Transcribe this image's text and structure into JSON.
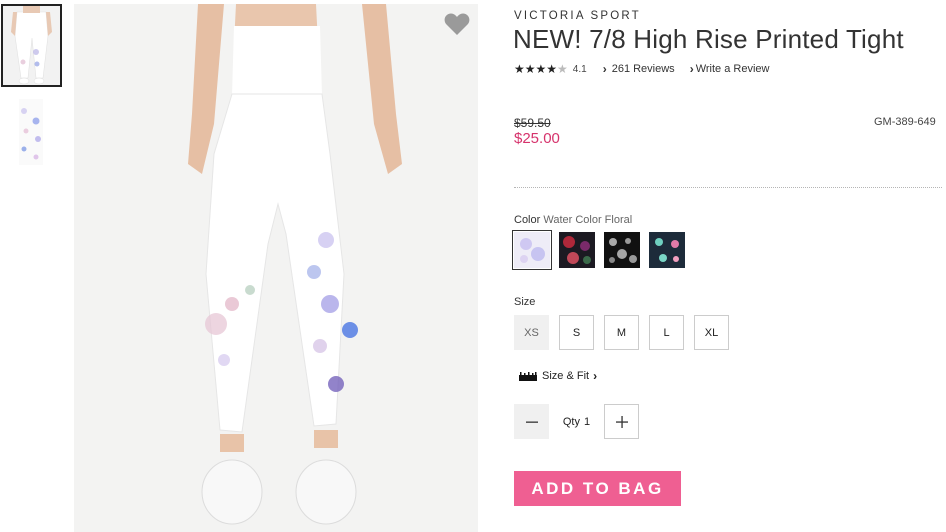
{
  "product": {
    "brand": "VICTORIA SPORT",
    "title": "NEW! 7/8 High Rise Printed Tight",
    "rating_value": "4.1",
    "reviews_link": "261 Reviews",
    "write_review_link": "Write a Review",
    "rating_stars": 4.1
  },
  "pricing": {
    "original_price": "$59.50",
    "sale_price": "$25.00",
    "sku": "GM-389-649",
    "sale_color": "#d6336c"
  },
  "color": {
    "label": "Color",
    "selected_name": "Water Color Floral",
    "swatches": [
      "water-color-floral",
      "dark-floral-red",
      "black-floral",
      "navy-floral"
    ]
  },
  "size": {
    "label": "Size",
    "options": [
      "XS",
      "S",
      "M",
      "L",
      "XL"
    ],
    "unavailable": [
      "XS"
    ],
    "size_fit_link": "Size & Fit"
  },
  "quantity": {
    "label": "Qty",
    "value": "1"
  },
  "actions": {
    "add_to_bag": "ADD TO BAG",
    "add_to_bag_color": "#ef5f92"
  },
  "icons": {
    "favorite": "heart-icon",
    "ruler": "ruler-icon"
  }
}
